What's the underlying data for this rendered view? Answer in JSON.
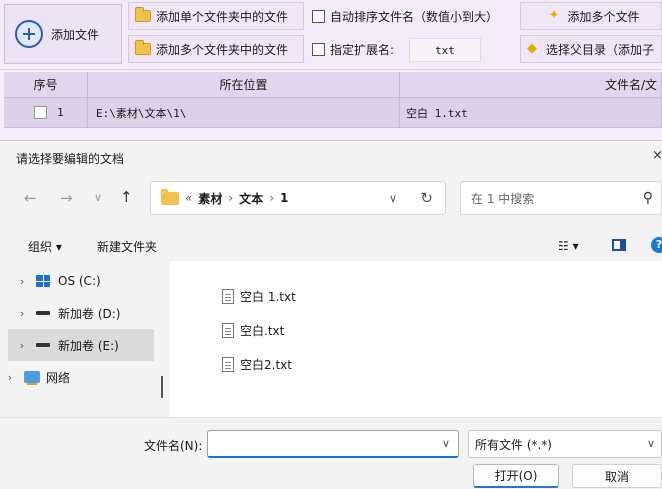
{
  "app": {
    "toolbar": {
      "add_file": "添加文件",
      "add_single_folder": "添加单个文件夹中的文件",
      "add_multi_folder": "添加多个文件夹中的文件",
      "auto_sort": "自动排序文件名（数值小到大）",
      "specify_ext": "指定扩展名:",
      "ext_value": "txt",
      "add_multi": "添加多个文件",
      "choose_parent": "选择父目录（添加子"
    },
    "grid": {
      "headers": [
        "序号",
        "所在位置",
        "文件名/文"
      ],
      "rows": [
        {
          "index": "1",
          "path": "E:\\素材\\文本\\1\\",
          "name": "空白 1.txt"
        }
      ]
    }
  },
  "dialog": {
    "title": "请选择要编辑的文档",
    "close": "×",
    "breadcrumb": {
      "prefix": "«",
      "parts": [
        "素材",
        "文本",
        "1"
      ],
      "sep": "›"
    },
    "search_placeholder": "在 1 中搜索",
    "commands": {
      "organize": "组织 ▾",
      "new_folder": "新建文件夹"
    },
    "nav": [
      {
        "label": "OS (C:)",
        "icon": "windows-drive-icon",
        "selected": false
      },
      {
        "label": "新加卷 (D:)",
        "icon": "drive-icon",
        "selected": false
      },
      {
        "label": "新加卷 (E:)",
        "icon": "drive-icon",
        "selected": true
      },
      {
        "label": "网络",
        "icon": "network-icon",
        "selected": false
      }
    ],
    "files": [
      "空白 1.txt",
      "空白.txt",
      "空白2.txt"
    ],
    "filename_label": "文件名(N):",
    "filename_value": "",
    "filetype": "所有文件 (*.*)",
    "open_button": "打开(O)",
    "cancel_button": "取消"
  }
}
